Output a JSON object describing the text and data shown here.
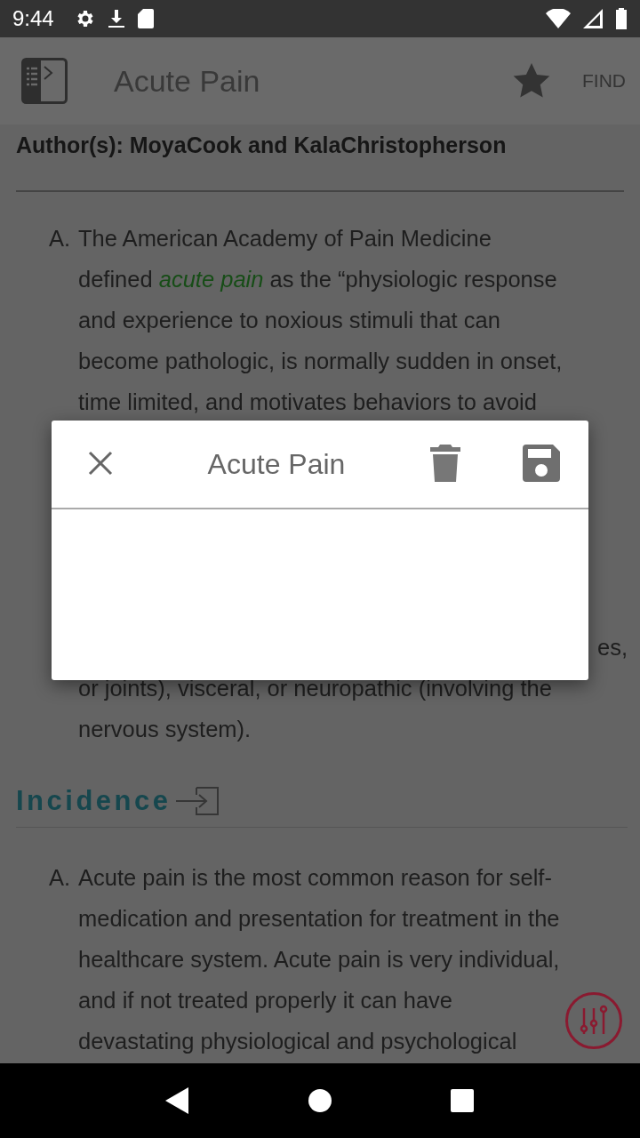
{
  "status_bar": {
    "time": "9:44"
  },
  "app_bar": {
    "title": "Acute Pain",
    "action": "FIND"
  },
  "authors": "Author(s): MoyaCook and KalaChristopherson",
  "paragraphs": [
    {
      "marker": "A.",
      "lines": [
        {
          "kind": "text",
          "text": "The American Academy of Pain Medicine"
        },
        {
          "kind": "text",
          "text": "defined *acute pain* as the “physiologic response"
        },
        {
          "kind": "text",
          "text": "and experience to noxious stimuli that can"
        },
        {
          "kind": "text",
          "text": "become pathologic, is normally sudden in onset,"
        },
        {
          "kind": "text",
          "text": "time limited, and motivates behaviors to avoid"
        },
        {
          "kind": "covered"
        },
        {
          "kind": "covered"
        },
        {
          "kind": "covered"
        },
        {
          "kind": "covered"
        },
        {
          "kind": "covered"
        },
        {
          "kind": "tail",
          "text": "es,"
        },
        {
          "kind": "text",
          "text": "or joints), visceral, or neuropathic (involving the"
        },
        {
          "kind": "text",
          "text": "nervous system)."
        }
      ]
    },
    {
      "kind": "heading",
      "title": "Incidence"
    },
    {
      "marker": "A.",
      "lines": [
        {
          "kind": "text",
          "text": "Acute pain is the most common reason for self-"
        },
        {
          "kind": "text",
          "text": "medication and presentation for treatment in the"
        },
        {
          "kind": "text",
          "text": "healthcare system. Acute pain is very individual,"
        },
        {
          "kind": "text",
          "text": "and if not treated properly it can have"
        },
        {
          "kind": "text",
          "text": "devastating physiological and psychological"
        }
      ]
    }
  ],
  "dialog": {
    "title": "Acute Pain"
  }
}
